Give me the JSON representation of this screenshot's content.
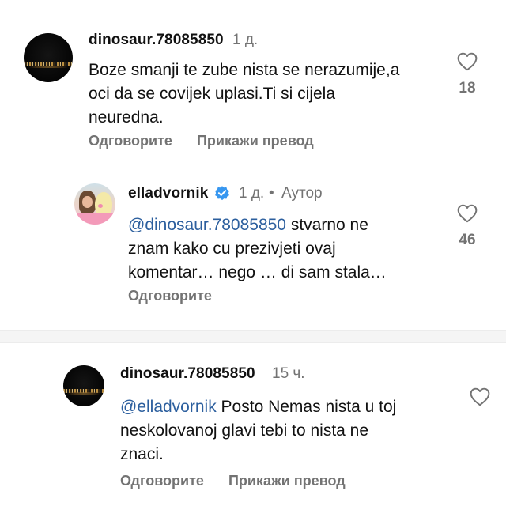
{
  "comments": [
    {
      "username": "dinosaur.78085850",
      "time": "1 д.",
      "text": "Boze smanji te zube nista se nerazumije,a oci da se covijek uplasi.Ti si cijela neuredna.",
      "text_lines": [
        "Boze smanji te zube nista se nerazumije,a",
        "oci da se covijek uplasi.Ti si cijela",
        "neuredna."
      ],
      "likes": "18",
      "reply_label": "Одговорите",
      "translate_label": "Прикажи превод"
    },
    {
      "username": "elladvornik",
      "time": "1 д.",
      "author_badge": "Аутор",
      "mention": "@dinosaur.78085850",
      "text_lines": [
        " stvarno ne",
        "znam kako cu prezivjeti ovaj",
        "komentar… nego … di sam stala…"
      ],
      "likes": "46",
      "reply_label": "Одговорите"
    },
    {
      "username": "dinosaur.78085850",
      "time": "15 ч.",
      "mention": "@elladvornik",
      "text_lines": [
        " Posto Nemas nista u toj",
        "neskolovanoj glavi tebi to nista ne",
        "znaci."
      ],
      "reply_label": "Одговорите",
      "translate_label": "Прикажи превод"
    }
  ],
  "colors": {
    "mention": "#2c5f9e",
    "verified": "#3797f0",
    "muted": "#737373"
  },
  "icons": {
    "like": "heart-outline-icon",
    "verified": "verified-badge-icon"
  }
}
